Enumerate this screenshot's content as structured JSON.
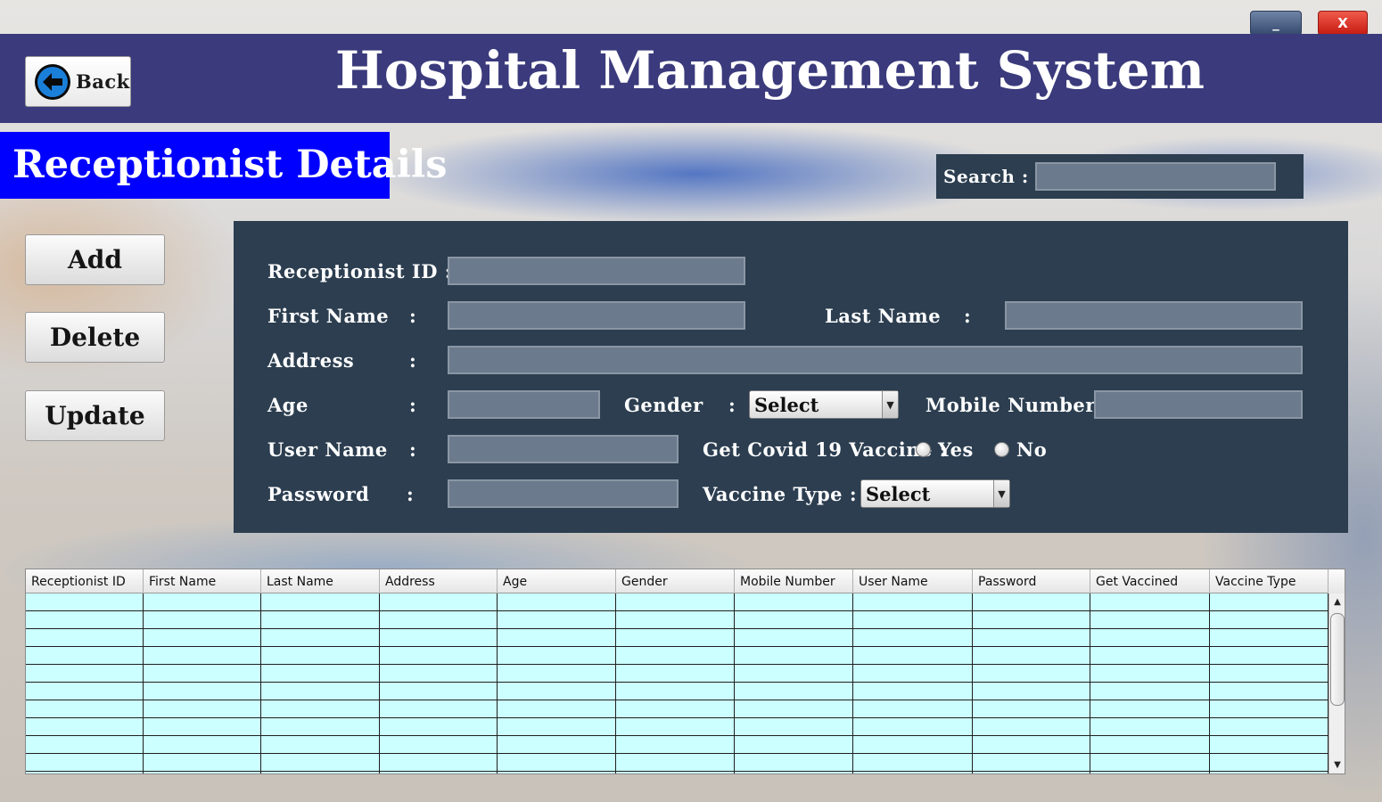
{
  "window": {
    "minimize_label": "_",
    "close_label": "X"
  },
  "header": {
    "title": "Hospital Management System",
    "back_label": "Back"
  },
  "section": {
    "title": "Receptionist Details"
  },
  "search": {
    "label": "Search :",
    "value": ""
  },
  "actions": {
    "add": "Add",
    "delete": "Delete",
    "update": "Update"
  },
  "form": {
    "receptionist_id": {
      "label": "Receptionist ID :",
      "value": ""
    },
    "first_name": {
      "label": "First Name",
      "colon": ":",
      "value": ""
    },
    "last_name": {
      "label": "Last Name",
      "colon": ":",
      "value": ""
    },
    "address": {
      "label": "Address",
      "colon": ":",
      "value": ""
    },
    "age": {
      "label": "Age",
      "colon": ":",
      "value": ""
    },
    "gender": {
      "label": "Gender",
      "colon": ":",
      "selected": "Select"
    },
    "mobile_number": {
      "label": "Mobile Number :",
      "value": ""
    },
    "user_name": {
      "label": "User Name",
      "colon": ":",
      "value": ""
    },
    "password": {
      "label": "Password",
      "colon": ":",
      "value": ""
    },
    "covid_vaccine": {
      "label": "Get Covid 19 Vaccine :",
      "options": [
        "Yes",
        "No"
      ]
    },
    "vaccine_type": {
      "label": "Vaccine Type :",
      "selected": "Select"
    }
  },
  "table": {
    "columns": [
      "Receptionist ID",
      "First Name",
      "Last Name",
      "Address",
      "Age",
      "Gender",
      "Mobile Number",
      "User Name",
      "Password",
      "Get Vaccined",
      "Vaccine Type"
    ],
    "rows": []
  },
  "icons": {
    "back": "back-arrow-icon",
    "scroll_up": "scroll-up-arrow-icon",
    "scroll_down": "scroll-down-arrow-icon",
    "dropdown": "chevron-down-icon"
  },
  "colors": {
    "header_band": "#3a3a7c",
    "section_title_bg": "#0000ff",
    "panel": "#2c3e50",
    "field": "#6b7a8c",
    "table_cell": "#ccffff",
    "close": "#d8271c"
  }
}
